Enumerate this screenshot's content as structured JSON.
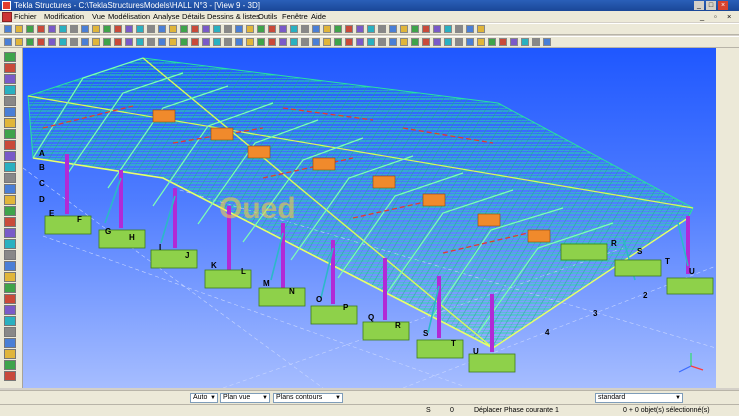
{
  "window": {
    "title": "Tekla Structures - C:\\TeklaStructuresModels\\HALL N°3 - [View 9 - 3D]",
    "controls": [
      "_",
      "□",
      "×"
    ]
  },
  "menu": [
    "Fichier",
    "Modification",
    "Vue",
    "Modélisation",
    "Analyse",
    "Détails",
    "Dessins & listes",
    "Outils",
    "Fenêtre",
    "Aide"
  ],
  "statusbar": {
    "combo1": "Auto",
    "combo2": "Plan vue",
    "combo3": "Plans contours",
    "combo4": "standard"
  },
  "bottom": {
    "s_label": "S",
    "s_value": "0",
    "message": "Déplacer  Phase courante 1",
    "selection": "0 + 0 objet(s) sélectionné(s)"
  },
  "model": {
    "watermark": "Oued",
    "axis_letters": [
      "F",
      "G",
      "H",
      "I",
      "J",
      "K",
      "L",
      "M",
      "N",
      "O",
      "P",
      "Q",
      "R",
      "S",
      "T",
      "U"
    ],
    "right_letters": [
      "R",
      "S",
      "T",
      "U"
    ],
    "axis_numbers": [
      "2",
      "3",
      "4"
    ],
    "left_letters": [
      "A",
      "B",
      "C",
      "D",
      "E"
    ],
    "colors": {
      "background_top": "#1f57ff",
      "background_bottom": "#9bb6ff",
      "truss": "#2ef0a0",
      "column": "#b12ad6",
      "footing": "#8ed14a"
    }
  }
}
